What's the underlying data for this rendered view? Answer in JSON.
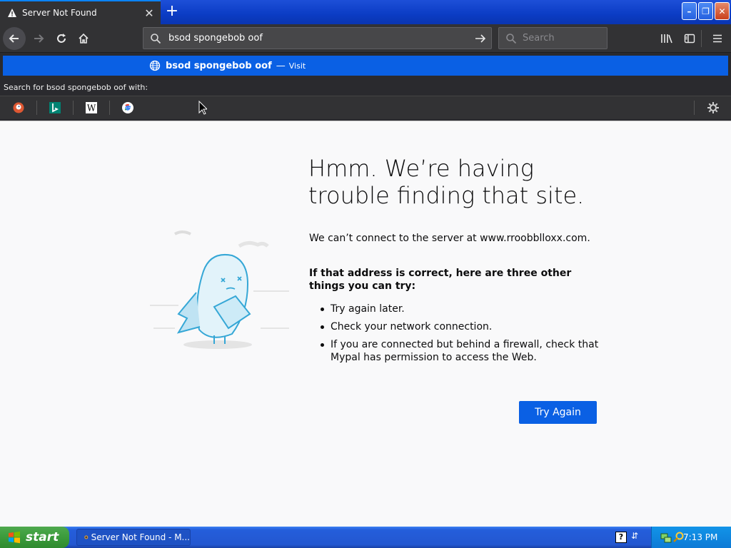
{
  "tab": {
    "title": "Server Not Found",
    "close_glyph": "✕",
    "new_tab_glyph": "+"
  },
  "window_controls": {
    "minimize": "–",
    "restore": "❐",
    "close": "✕"
  },
  "urlbar": {
    "value": "bsod spongebob oof"
  },
  "searchbar": {
    "placeholder": "Search"
  },
  "suggestion": {
    "text": "bsod spongebob oof",
    "separator": "—",
    "action": "Visit"
  },
  "search_with": "Search for bsod spongebob oof with:",
  "engines": [
    "duckduckgo-icon",
    "bing-icon",
    "wikipedia-icon",
    "google-icon"
  ],
  "error_page": {
    "title": "Hmm. We’re having trouble finding that site.",
    "description": "We can’t connect to the server at www.rroobblloxx.com.",
    "subtitle": "If that address is correct, here are three other things you can try:",
    "tips": [
      "Try again later.",
      "Check your network connection.",
      "If you are connected but behind a firewall, check that Mypal has permission to access the Web."
    ],
    "button": "Try Again"
  },
  "taskbar": {
    "start": "start",
    "task_label": "Server Not Found - M...",
    "clock": "7:13 PM"
  },
  "colors": {
    "accent": "#0a60e4",
    "toolbar": "#323234",
    "page_bg": "#f9f9fa"
  }
}
